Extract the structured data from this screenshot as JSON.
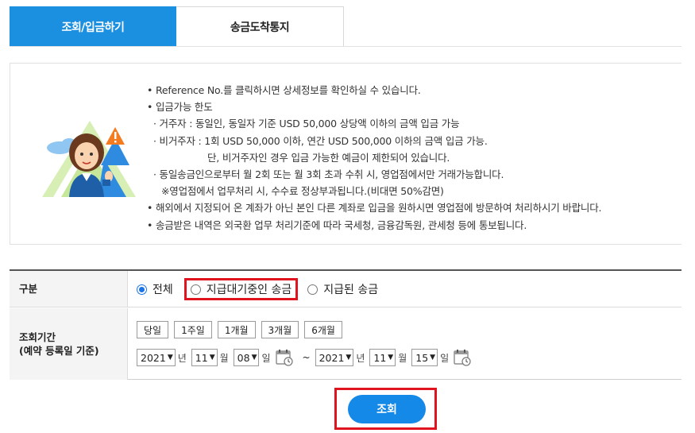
{
  "tabs": [
    {
      "label": "조회/입금하기",
      "active": true
    },
    {
      "label": "송금도착통지",
      "active": false
    }
  ],
  "notice": {
    "lines": [
      "• Reference No.를 클릭하시면 상세정보를 확인하실 수 있습니다.",
      "• 입금가능 한도",
      "· 거주자 : 동일인, 동일자 기준 USD 50,000 상당액 이하의 금액 입금 가능",
      "· 비거주자 : 1회 USD 50,000 이하, 연간 USD 500,000 이하의 금액 입금 가능.",
      "단, 비거주자인 경우 입금 가능한 예금이 제한되어 있습니다.",
      "· 동일송금인으로부터 월 2회 또는 월 3회 초과 수취 시, 영업점에서만 거래가능합니다.",
      "※영업점에서 업무처리 시, 수수료 정상부과됩니다.(비대면 50%감면)",
      "• 해외에서 지정되어 온 계좌가 아닌 본인 다른 계좌로 입금을 원하시면 영업점에 방문하여 처리하시기 바랍니다.",
      "• 송금받은 내역은 외국환 업무 처리기준에 따라 국세청, 금융감독원, 관세청 등에 통보됩니다."
    ]
  },
  "form": {
    "type_label": "구분",
    "radios": [
      {
        "label": "전체",
        "checked": true
      },
      {
        "label": "지급대기중인 송금",
        "checked": false
      },
      {
        "label": "지급된 송금",
        "checked": false
      }
    ],
    "period_label_1": "조회기간",
    "period_label_2": "(예약 등록일 기준)",
    "quick_buttons": [
      "당일",
      "1주일",
      "1개월",
      "3개월",
      "6개월"
    ],
    "from": {
      "year": "2021",
      "month": "11",
      "day": "08"
    },
    "to": {
      "year": "2021",
      "month": "11",
      "day": "15"
    },
    "units": {
      "year": "년",
      "month": "월",
      "day": "일",
      "tilde": "~"
    }
  },
  "search_button": "조회",
  "colors": {
    "primary": "#1b8fe0",
    "highlight": "#e0141e",
    "button": "#1489e8"
  }
}
